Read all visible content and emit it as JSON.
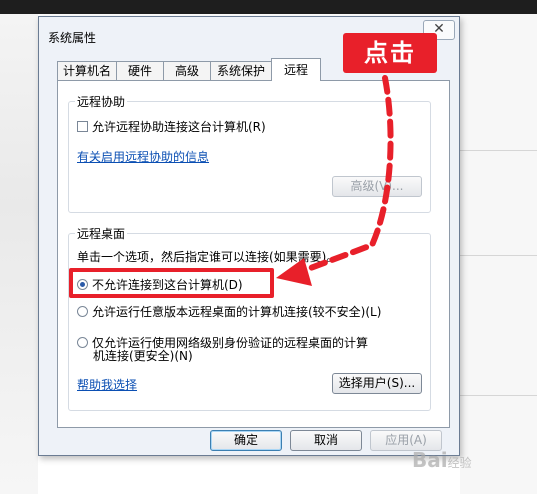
{
  "dialog": {
    "title": "系统属性",
    "close_glyph": "✕",
    "tabs": [
      {
        "label": "计算机名"
      },
      {
        "label": "硬件"
      },
      {
        "label": "高级"
      },
      {
        "label": "系统保护"
      },
      {
        "label": "远程",
        "active": true
      }
    ],
    "remote_assistance": {
      "group_label": "远程协助",
      "checkbox_label": "允许远程协助连接这台计算机(R)",
      "checked": false,
      "info_link": "有关启用远程协助的信息",
      "advanced_button": "高级(V)..."
    },
    "remote_desktop": {
      "group_label": "远程桌面",
      "instruction": "单击一个选项，然后指定谁可以连接(如果需要)。",
      "options": [
        {
          "label": "不允许连接到这台计算机(D)",
          "selected": true
        },
        {
          "label": "允许运行任意版本远程桌面的计算机连接(较不安全)(L)",
          "selected": false
        },
        {
          "label_line1": "仅允许运行使用网络级别身份验证的远程桌面的计算",
          "label_line2": "机连接(更安全)(N)",
          "selected": false
        }
      ],
      "help_link": "帮助我选择",
      "select_users_button": "选择用户(S)..."
    },
    "buttons": {
      "ok": "确定",
      "cancel": "取消",
      "apply": "应用(A)"
    }
  },
  "annotation": {
    "callout_text": "点击",
    "color": "#e8202a"
  },
  "watermark": {
    "text": "Bai",
    "suffix": "经验"
  }
}
